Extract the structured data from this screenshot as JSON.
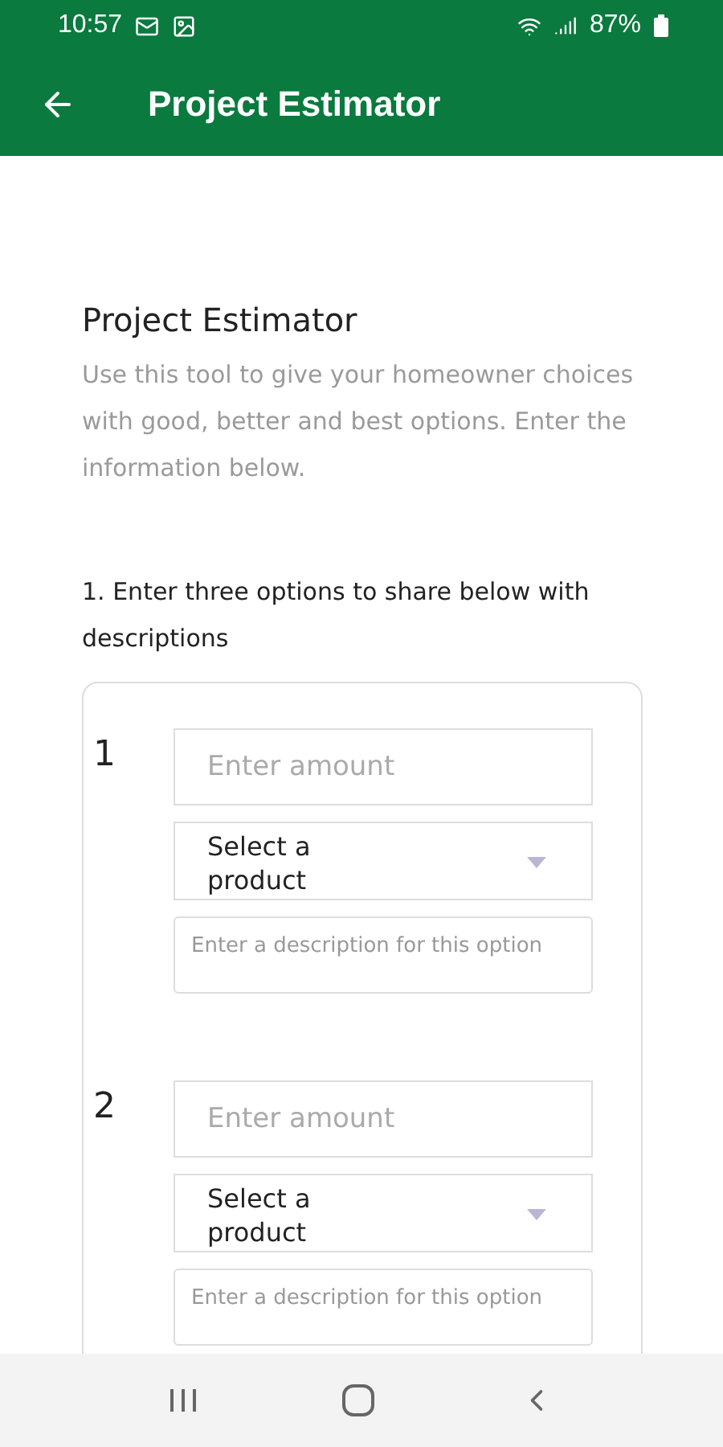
{
  "status_bar": {
    "time": "10:57",
    "battery": "87%"
  },
  "app_bar": {
    "title": "Project Estimator"
  },
  "page": {
    "heading": "Project Estimator",
    "intro": "Use this tool to give your homeowner choices with good, better and best options. Enter the information below."
  },
  "step": {
    "label": "1.  Enter three options to share below with descriptions"
  },
  "options": [
    {
      "number": "1",
      "amount": {
        "placeholder": "Enter amount"
      },
      "product": {
        "value": "Select a product"
      },
      "description": {
        "placeholder": "Enter a description for this option"
      }
    },
    {
      "number": "2",
      "amount": {
        "placeholder": "Enter amount"
      },
      "product": {
        "value": "Select a product"
      },
      "description": {
        "placeholder": "Enter a description for this option"
      }
    }
  ]
}
